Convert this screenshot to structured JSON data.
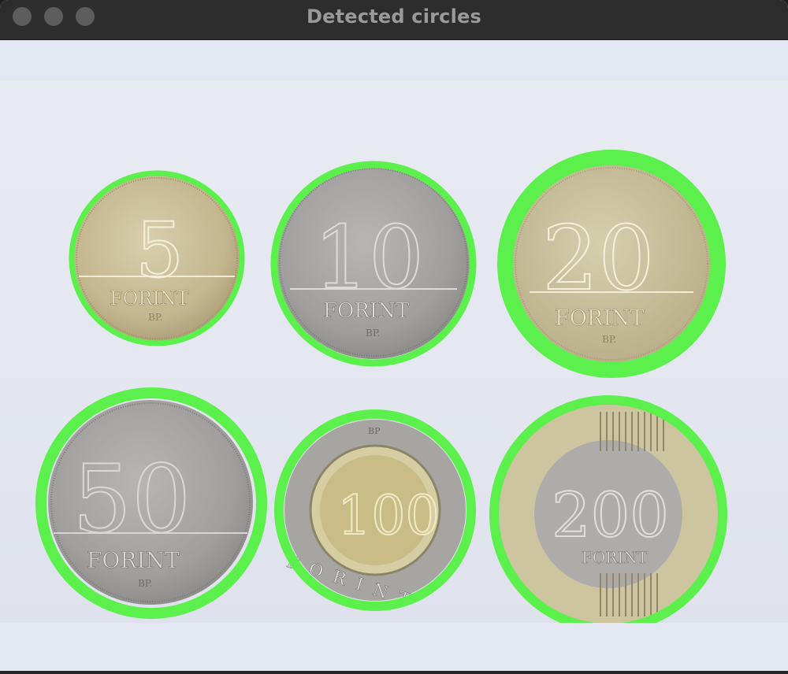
{
  "window": {
    "title": "Detected circles"
  },
  "image": {
    "description_icon": "coin-photo-icon",
    "detection_color": "#5cf04c",
    "coins": [
      {
        "value": "5",
        "text": "FORINT",
        "mint": "BP."
      },
      {
        "value": "10",
        "text": "FORINT",
        "mint": "BP."
      },
      {
        "value": "20",
        "text": "FORINT",
        "mint": "BP."
      },
      {
        "value": "50",
        "text": "FORINT",
        "mint": "BP."
      },
      {
        "value": "100",
        "text": "FORINT",
        "mint": "BP"
      },
      {
        "value": "200",
        "text": "FORINT",
        "mint": ""
      }
    ]
  }
}
